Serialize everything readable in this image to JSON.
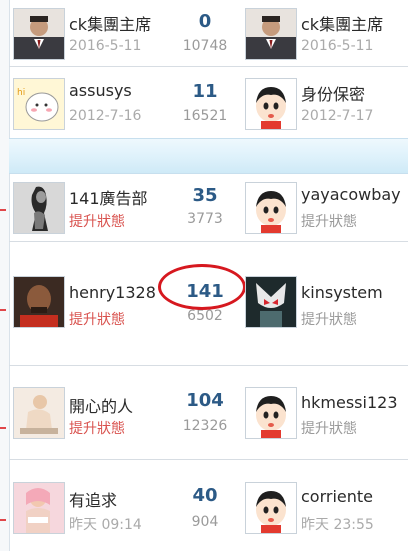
{
  "rows": [
    {
      "left_name": "ck集團主席",
      "left_sub": "2016-5-11",
      "left_avatar": "avatar-man-suit",
      "count": "0",
      "views": "10748",
      "right_name": "ck集團主席",
      "right_sub": "2016-5-11",
      "right_avatar": "avatar-man-suit"
    },
    {
      "left_name": "assusys",
      "left_sub": "2012-7-16",
      "left_avatar": "avatar-cartoon-yellow",
      "count": "11",
      "views": "16521",
      "right_name": "身份保密",
      "right_sub": "2012-7-17",
      "right_avatar": "avatar-default-boy"
    },
    {
      "left_name": "141廣告部",
      "left_sub": "提升狀態",
      "left_avatar": "avatar-bw-woman",
      "count": "35",
      "views": "3773",
      "right_name": "yayacowbay",
      "right_sub": "提升狀態",
      "right_avatar": "avatar-default-boy"
    },
    {
      "left_name": "henry1328",
      "left_sub": "提升狀態",
      "left_avatar": "avatar-bald-man",
      "count": "141",
      "views": "6502",
      "right_name": "kinsystem",
      "right_sub": "提升狀態",
      "right_avatar": "avatar-masked-rider"
    },
    {
      "left_name": "開心的人",
      "left_sub": "提升狀態",
      "left_avatar": "avatar-figurine",
      "count": "104",
      "views": "12326",
      "right_name": "hkmessi123",
      "right_sub": "提升狀態",
      "right_avatar": "avatar-default-boy"
    },
    {
      "left_name": "有追求",
      "left_sub": "昨天 09:14",
      "left_avatar": "avatar-woman-pink",
      "count": "40",
      "views": "904",
      "right_name": "corriente",
      "right_sub": "昨天 23:55",
      "right_avatar": "avatar-default-boy"
    }
  ],
  "colors": {
    "accent": "#2c5a86",
    "status_red": "#d9534f",
    "highlight_circle": "#d6181f"
  }
}
